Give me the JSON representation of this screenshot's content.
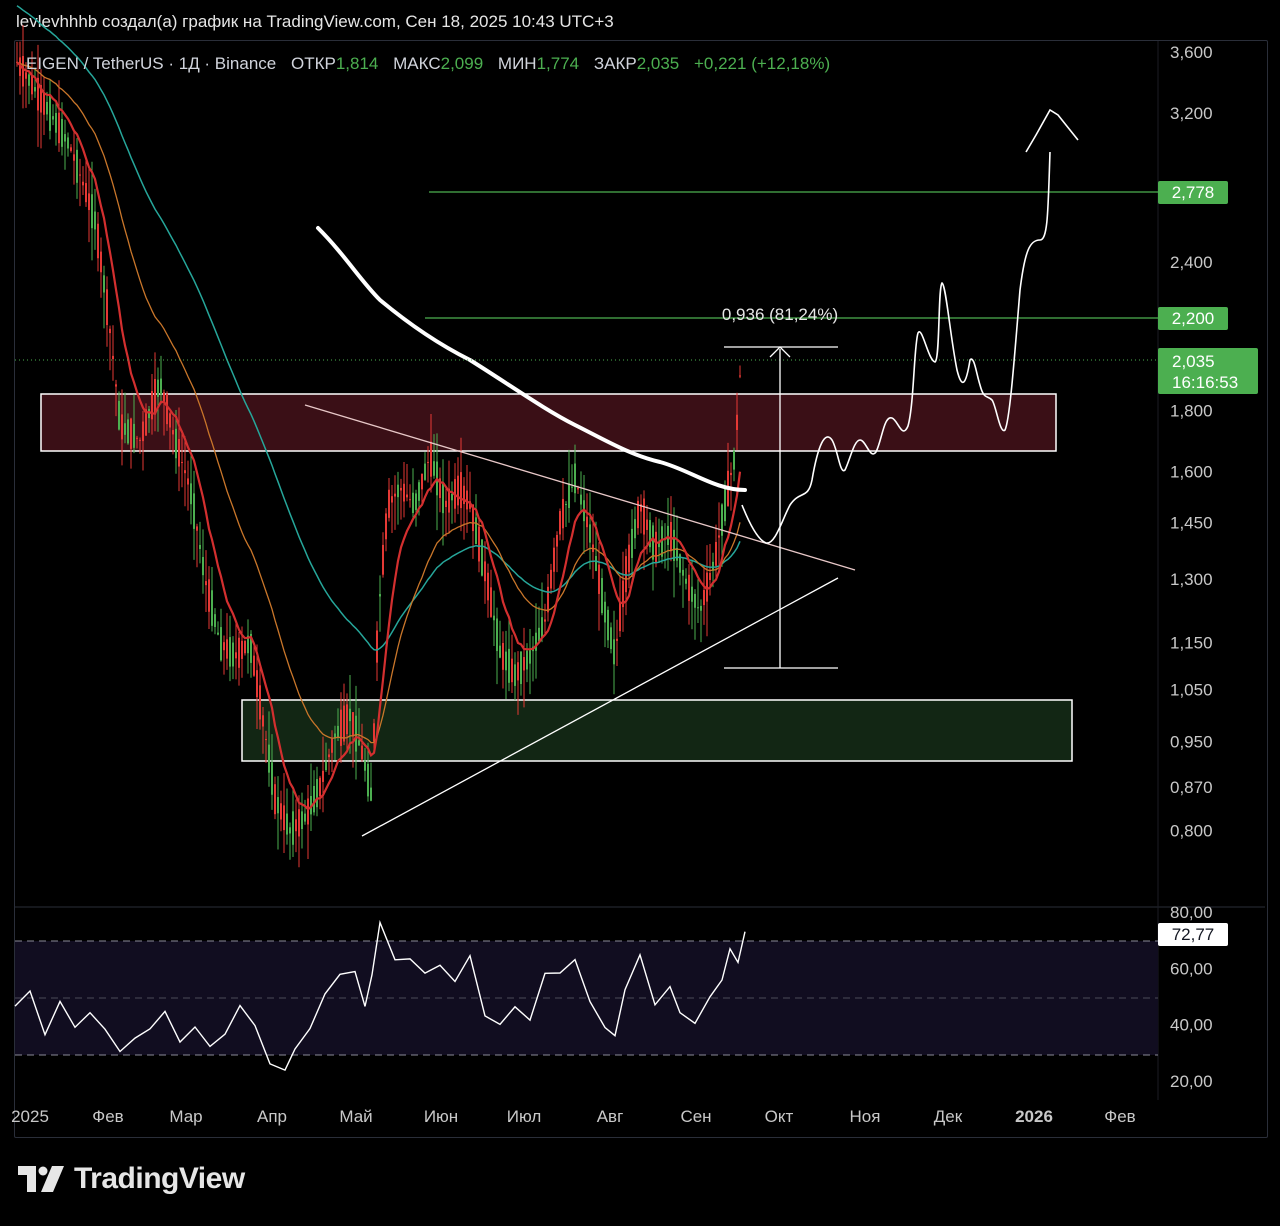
{
  "caption": "levlevhhhb создал(а) график на TradingView.com, Сен 18, 2025 10:43 UTC+3",
  "legend": {
    "symbol": "EIGEN / TetherUS · 1Д · Binance",
    "open_label": "ОТКР",
    "open": "1,814",
    "high_label": "МАКС",
    "high": "2,099",
    "low_label": "МИН",
    "low": "1,774",
    "close_label": "ЗАКР",
    "close": "2,035",
    "change": "+0,221 (+12,18%)"
  },
  "brand": "TradingView",
  "colors": {
    "up": "#4caf50",
    "down": "#e53935",
    "ema_red": "#d32f2f",
    "ema_orange": "#c9762a",
    "ema_teal": "#26a69a",
    "accent_green": "#4caf50"
  },
  "chart_data": [
    {
      "type": "candlestick",
      "title": "",
      "x_tick_labels": [
        "2025",
        "Фев",
        "Мар",
        "Апр",
        "Май",
        "Июн",
        "Июл",
        "Авг",
        "Сен",
        "Окт",
        "Ноя",
        "Дек",
        "2026",
        "Фев"
      ],
      "y_tick_labels": [
        "3,600",
        "3,200",
        "2,400",
        "1,800",
        "1,600",
        "1,450",
        "1,300",
        "1,150",
        "1,050",
        "0,950",
        "0,870",
        "0,800"
      ],
      "y_scale": "log",
      "ylim": [
        0.74,
        3.7
      ],
      "price_labels": [
        {
          "value": "2,778",
          "price": 2.778
        },
        {
          "value": "2,200",
          "price": 2.2
        }
      ],
      "last_price": {
        "value": "2,035",
        "countdown": "16:16:53",
        "price": 2.035
      },
      "measure_label": "0,936 (81,24%)",
      "zones": [
        {
          "name": "resistance-zone",
          "from": 1.74,
          "to": 1.92,
          "start": "Янв",
          "end": "Дек"
        },
        {
          "name": "support-zone",
          "from": 0.97,
          "to": 1.09,
          "start": "Мар",
          "end": "Дек"
        }
      ],
      "key_points": [
        {
          "month": "Апр",
          "low": 0.76
        },
        {
          "month": "Июн",
          "high": 1.79
        },
        {
          "month": "Сен",
          "close": 2.035
        }
      ]
    },
    {
      "type": "line",
      "title": "",
      "y_tick_labels": [
        "80,00",
        "60,00",
        "40,00",
        "20,00"
      ],
      "ylim": [
        15,
        82
      ],
      "last_value": {
        "value": "72,77",
        "v": 72.77
      },
      "bands": [
        70,
        30
      ]
    }
  ]
}
